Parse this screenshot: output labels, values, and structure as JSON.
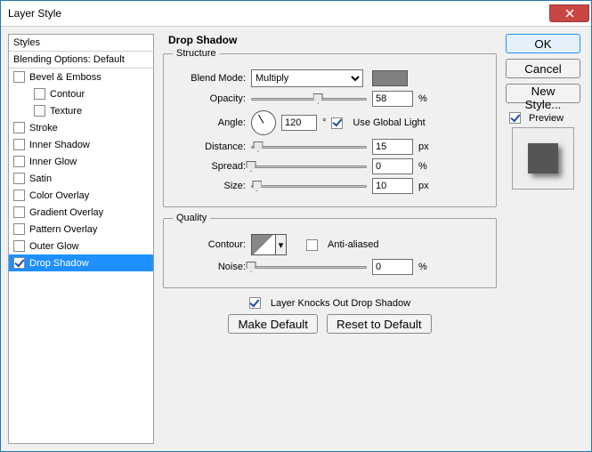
{
  "window": {
    "title": "Layer Style"
  },
  "sidebar": {
    "header": "Styles",
    "blending": "Blending Options: Default",
    "items": [
      {
        "label": "Bevel & Emboss",
        "checked": false,
        "indent": false
      },
      {
        "label": "Contour",
        "checked": false,
        "indent": true
      },
      {
        "label": "Texture",
        "checked": false,
        "indent": true
      },
      {
        "label": "Stroke",
        "checked": false,
        "indent": false
      },
      {
        "label": "Inner Shadow",
        "checked": false,
        "indent": false
      },
      {
        "label": "Inner Glow",
        "checked": false,
        "indent": false
      },
      {
        "label": "Satin",
        "checked": false,
        "indent": false
      },
      {
        "label": "Color Overlay",
        "checked": false,
        "indent": false
      },
      {
        "label": "Gradient Overlay",
        "checked": false,
        "indent": false
      },
      {
        "label": "Pattern Overlay",
        "checked": false,
        "indent": false
      },
      {
        "label": "Outer Glow",
        "checked": false,
        "indent": false
      },
      {
        "label": "Drop Shadow",
        "checked": true,
        "indent": false,
        "selected": true
      }
    ]
  },
  "main": {
    "title": "Drop Shadow",
    "structure": {
      "legend": "Structure",
      "blend_mode_label": "Blend Mode:",
      "blend_mode_value": "Multiply",
      "opacity_label": "Opacity:",
      "opacity_value": "58",
      "opacity_unit": "%",
      "angle_label": "Angle:",
      "angle_value": "120",
      "angle_unit": "°",
      "global_light_label": "Use Global Light",
      "global_light_checked": true,
      "distance_label": "Distance:",
      "distance_value": "15",
      "distance_unit": "px",
      "spread_label": "Spread:",
      "spread_value": "0",
      "spread_unit": "%",
      "size_label": "Size:",
      "size_value": "10",
      "size_unit": "px"
    },
    "quality": {
      "legend": "Quality",
      "contour_label": "Contour:",
      "antialiased_label": "Anti-aliased",
      "antialiased_checked": false,
      "noise_label": "Noise:",
      "noise_value": "0",
      "noise_unit": "%"
    },
    "knockout": {
      "label": "Layer Knocks Out Drop Shadow",
      "checked": true
    },
    "make_default": "Make Default",
    "reset_default": "Reset to Default"
  },
  "right": {
    "ok": "OK",
    "cancel": "Cancel",
    "new_style": "New Style...",
    "preview_label": "Preview",
    "preview_checked": true
  },
  "colors": {
    "shadow_swatch": "#808080",
    "selection": "#1e90ff"
  }
}
